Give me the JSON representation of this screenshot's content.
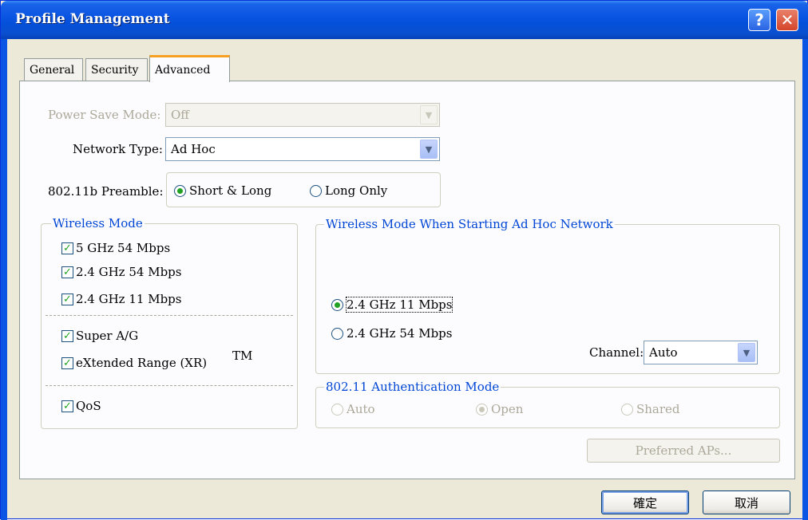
{
  "window": {
    "title": "Profile Management"
  },
  "tabs": [
    "General",
    "Security",
    "Advanced"
  ],
  "power_save": {
    "label": "Power Save Mode:",
    "value": "Off"
  },
  "network_type": {
    "label": "Network Type:",
    "value": "Ad Hoc"
  },
  "preamble": {
    "label": "802.11b Preamble:",
    "options": [
      "Short & Long",
      "Long Only"
    ],
    "selected": "Short & Long"
  },
  "wireless_mode": {
    "title": "Wireless Mode",
    "items": [
      "5 GHz 54 Mbps",
      "2.4 GHz 54 Mbps",
      "2.4 GHz 11 Mbps",
      "Super A/G",
      "eXtended Range (XR)",
      "QoS"
    ],
    "tm": "TM"
  },
  "adhoc": {
    "title": "Wireless Mode When Starting Ad Hoc Network",
    "options": [
      "2.4 GHz 11 Mbps",
      "2.4 GHz 54 Mbps"
    ],
    "selected": "2.4 GHz 11 Mbps",
    "channel_label": "Channel:",
    "channel_value": "Auto"
  },
  "auth": {
    "title": "802.11 Authentication Mode",
    "options": [
      "Auto",
      "Open",
      "Shared"
    ],
    "selected": "Open"
  },
  "preferred_aps": "Preferred APs...",
  "buttons": {
    "ok": "確定",
    "cancel": "取消"
  },
  "colors": {
    "title_bar": "#0a55e3",
    "group_title": "#0046d5",
    "check": "#21a121",
    "tab_accent": "#f5a020"
  }
}
